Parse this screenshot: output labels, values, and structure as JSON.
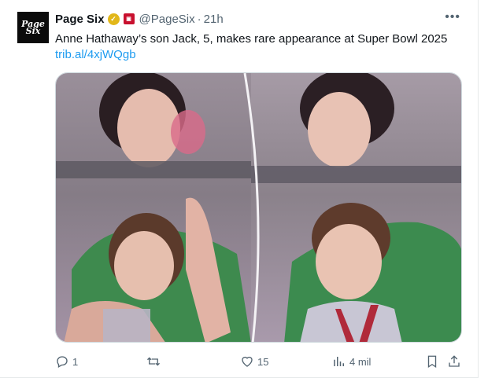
{
  "account": {
    "name": "Page Six",
    "handle": "@PageSix",
    "separator": "·",
    "time": "21h",
    "avatar_text": "Page\nSix",
    "verified_color": "#e2b719",
    "affiliate_badge_color": "#c8102e"
  },
  "tweet": {
    "text": "Anne Hathaway’s son Jack, 5, makes rare appearance at Super Bowl 2025",
    "link": "trib.al/4xjWQgb"
  },
  "actions": {
    "replies": "1",
    "reposts": "",
    "likes": "15",
    "views": "4 mil"
  },
  "icons": {
    "more": "more-options-icon",
    "reply": "reply-icon",
    "repost": "repost-icon",
    "like": "like-icon",
    "views": "views-icon",
    "bookmark": "bookmark-icon",
    "share": "share-icon"
  },
  "colors": {
    "link": "#1d9bf0",
    "secondary_text": "#536471"
  }
}
